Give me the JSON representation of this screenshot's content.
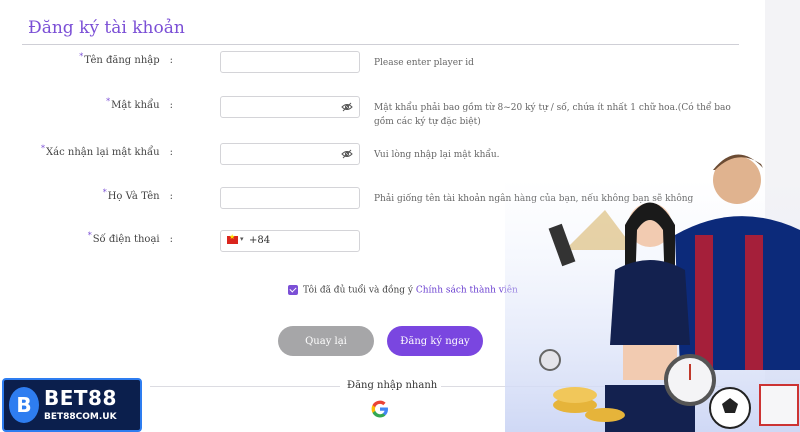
{
  "form": {
    "title": "Đăng ký tài khoản",
    "fields": [
      {
        "label": "Tên đăng nhập",
        "colon": ":",
        "value": "",
        "hint": "Please enter player id"
      },
      {
        "label": "Mật khẩu",
        "colon": ":",
        "value": "",
        "hint": "Mật khẩu phải bao gồm từ 8~20 ký tự / số, chứa ít nhất 1 chữ hoa.(Có thể bao gồm các ký tự đặc biệt)"
      },
      {
        "label": "Xác nhận lại mật khẩu",
        "colon": ":",
        "value": "",
        "hint": "Vui lòng nhập lại mật khẩu."
      },
      {
        "label": "Họ Và Tên",
        "colon": ":",
        "value": "",
        "hint": "Phải giống tên tài khoản ngân hàng của bạn, nếu không bạn sẽ không"
      },
      {
        "label": "Số điện thoại",
        "colon": ":",
        "value": "",
        "dial_code": "+84"
      }
    ],
    "agree_text": "Tôi đã đủ tuổi và đồng ý",
    "policy_link": "Chính sách thành viên",
    "back_button": "Quay lại",
    "register_button": "Đăng ký ngay",
    "quick_login": "Đăng nhập nhanh"
  },
  "logo": {
    "name": "BET88",
    "url": "BET88COM.UK"
  },
  "colors": {
    "accent": "#7b4fd6",
    "button_primary": "#7a46e0",
    "button_secondary": "#a6a6a8"
  },
  "icons": [
    "eye-off-icon",
    "vietnam-flag-icon",
    "google-icon"
  ]
}
